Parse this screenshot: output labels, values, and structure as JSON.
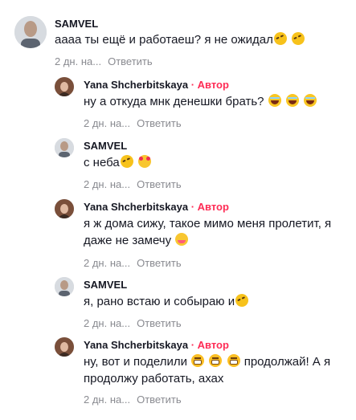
{
  "comments": [
    {
      "author": "SAMVEL",
      "badge": "",
      "text": "аааа ты ещё и работаеш? я не ожидал",
      "emojis": [
        "rofl-emoji",
        "rofl-emoji"
      ],
      "date": "2 дн. на...",
      "reply": "Ответить"
    },
    {
      "author": "Yana Shcherbitskaya",
      "badge": "· Автор",
      "text": "ну а откуда мнк денешки брать?",
      "emojis": [
        "laugh-emoji",
        "laugh-emoji",
        "laugh-emoji"
      ],
      "date": "2 дн. на...",
      "reply": "Ответить"
    },
    {
      "author": "SAMVEL",
      "badge": "",
      "text": "с неба",
      "emojis": [
        "rofl-emoji",
        "smiling-hearts-emoji"
      ],
      "date": "2 дн. на...",
      "reply": "Ответить"
    },
    {
      "author": "Yana Shcherbitskaya",
      "badge": "· Автор",
      "text": "я ж дома сижу, такое мимо меня пролетит, я даже не замечу",
      "emojis": [
        "smile-emoji"
      ],
      "date": "2 дн. на...",
      "reply": "Ответить"
    },
    {
      "author": "SAMVEL",
      "badge": "",
      "text": "я, рано встаю и собыраю и",
      "emojis": [
        "rofl-emoji"
      ],
      "date": "2 дн. на...",
      "reply": "Ответить"
    },
    {
      "author": "Yana Shcherbitskaya",
      "badge": "· Автор",
      "text_part1": "ну, вот и поделили",
      "text_part2": "продолжай! А я продолжу работать, ахах",
      "emojis": [
        "grin-emoji",
        "grin-emoji",
        "grin-emoji"
      ],
      "date": "2 дн. на...",
      "reply": "Ответить"
    }
  ]
}
